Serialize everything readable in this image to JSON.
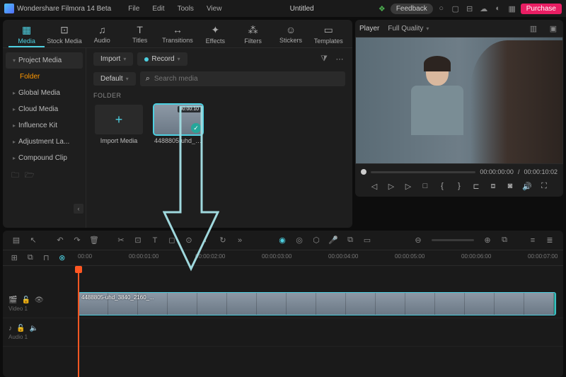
{
  "app": {
    "name": "Wondershare Filmora 14 Beta",
    "project_title": "Untitled"
  },
  "menu": [
    "File",
    "Edit",
    "Tools",
    "View"
  ],
  "titlebar_buttons": {
    "feedback": "Feedback",
    "purchase": "Purchase"
  },
  "tabs": [
    {
      "icon": "▦",
      "label": "Media",
      "active": true
    },
    {
      "icon": "⊡",
      "label": "Stock Media"
    },
    {
      "icon": "♫",
      "label": "Audio"
    },
    {
      "icon": "T",
      "label": "Titles"
    },
    {
      "icon": "↔",
      "label": "Transitions"
    },
    {
      "icon": "✦",
      "label": "Effects"
    },
    {
      "icon": "⁂",
      "label": "Filters"
    },
    {
      "icon": "☺",
      "label": "Stickers"
    },
    {
      "icon": "▭",
      "label": "Templates"
    }
  ],
  "sidebar": {
    "items": [
      {
        "label": "Project Media",
        "active": true
      },
      {
        "label": "Global Media"
      },
      {
        "label": "Cloud Media"
      },
      {
        "label": "Influence Kit"
      },
      {
        "label": "Adjustment La..."
      },
      {
        "label": "Compound Clip"
      }
    ],
    "folder_label": "Folder"
  },
  "content": {
    "import_btn": "Import",
    "record_btn": "Record",
    "sort_default": "Default",
    "search_placeholder": "Search media",
    "folder_header": "FOLDER",
    "import_media_label": "Import Media",
    "clip_name": "4488805-uhd_38...",
    "clip_duration": "00:00:10"
  },
  "player": {
    "tab": "Player",
    "quality": "Full Quality",
    "time_current": "00:00:00:00",
    "time_total": "00:00:10:02"
  },
  "timeline": {
    "marks": [
      "00:00",
      "00:00:01:00",
      "00:00:02:00",
      "00:00:03:00",
      "00:00:04:00",
      "00:00:05:00",
      "00:00:06:00",
      "00:00:07:00"
    ],
    "track_video": "Video 1",
    "track_audio": "Audio 1",
    "clip_label": "4488805-uhd_3840_2160_..."
  }
}
